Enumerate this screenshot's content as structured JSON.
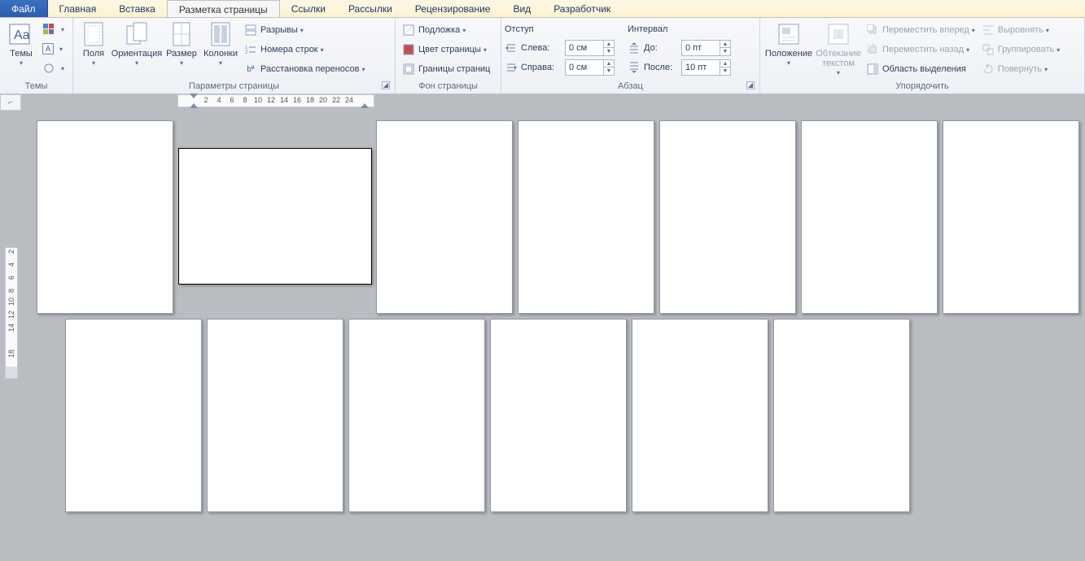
{
  "tabs": {
    "file": "Файл",
    "items": [
      "Главная",
      "Вставка",
      "Разметка страницы",
      "Ссылки",
      "Рассылки",
      "Рецензирование",
      "Вид",
      "Разработчик"
    ],
    "active_index": 2
  },
  "ribbon": {
    "themes": {
      "label": "Темы",
      "button": "Темы"
    },
    "page_setup": {
      "label": "Параметры страницы",
      "margins": "Поля",
      "orientation": "Ориентация",
      "size": "Размер",
      "columns": "Колонки",
      "breaks": "Разрывы",
      "line_numbers": "Номера строк",
      "hyphenation": "Расстановка переносов"
    },
    "page_bg": {
      "label": "Фон страницы",
      "watermark": "Подложка",
      "page_color": "Цвет страницы",
      "page_borders": "Границы страниц"
    },
    "paragraph": {
      "label": "Абзац",
      "indent_header": "Отступ",
      "spacing_header": "Интервал",
      "left_label": "Слева:",
      "right_label": "Справа:",
      "before_label": "До:",
      "after_label": "После:",
      "left_value": "0 см",
      "right_value": "0 см",
      "before_value": "0 пт",
      "after_value": "10 пт"
    },
    "arrange": {
      "label": "Упорядочить",
      "position": "Положение",
      "wrap": "Обтекание текстом",
      "bring_forward": "Переместить вперед",
      "send_backward": "Переместить назад",
      "selection_pane": "Область выделения",
      "align": "Выровнять",
      "group": "Группировать",
      "rotate": "Повернуть"
    }
  },
  "ruler": {
    "h_ticks": [
      "",
      "2",
      "4",
      "6",
      "8",
      "10",
      "12",
      "14",
      "16",
      "18",
      "20",
      "22",
      "24"
    ],
    "v_ticks": [
      "2",
      "4",
      "6",
      "8",
      "10",
      "12",
      "14",
      "",
      "18"
    ]
  }
}
